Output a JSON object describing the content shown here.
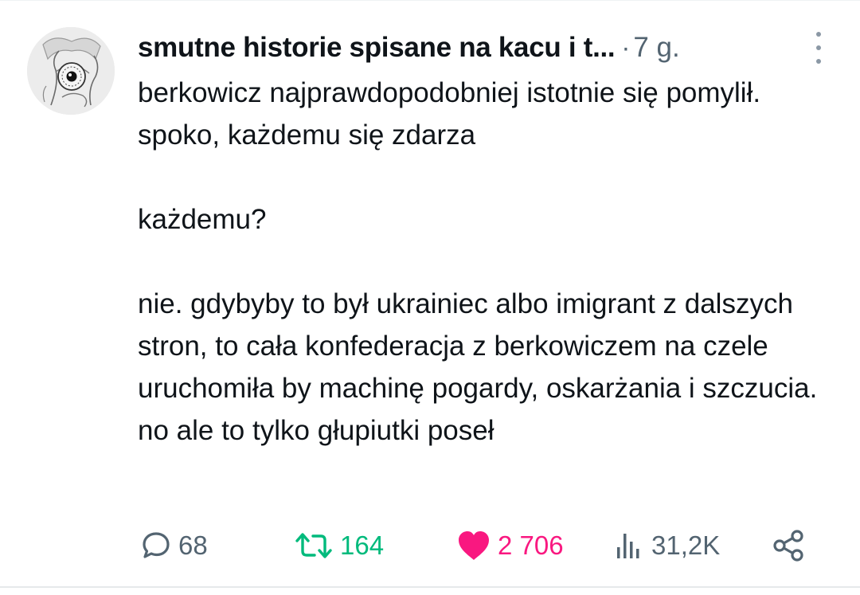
{
  "post": {
    "author": "smutne historie spisane na kacu i t...",
    "separator": "·",
    "time": "7 g.",
    "paragraphs": [
      "berkowicz najprawdopodobniej istotnie się pomylił. spoko, każdemu się zdarza",
      "każdemu?",
      "nie. gdybyby to był ukrainiec albo imigrant z dalszych stron, to cała konfederacja z berkowiczem na czele uruchomiła by machinę pogardy, oskarżania i szczucia. no ale to tylko głupiutki poseł"
    ]
  },
  "actions": {
    "replies": "68",
    "reposts": "164",
    "likes": "2 706",
    "views": "31,2K"
  },
  "icons": {
    "more": "more-vertical-icon",
    "reply": "speech-bubble-icon",
    "repost": "repost-arrows-icon",
    "like": "heart-icon",
    "views": "bar-chart-icon",
    "share": "share-icon"
  },
  "colors": {
    "text": "#0f1419",
    "muted": "#536471",
    "repost_active": "#00ba7c",
    "like_active": "#f91880"
  }
}
